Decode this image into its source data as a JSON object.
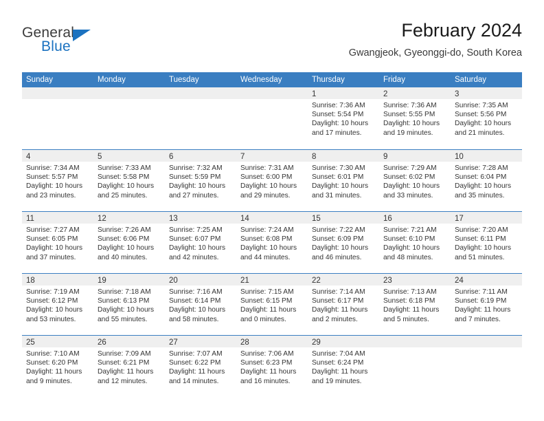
{
  "logo": {
    "word_top": "General",
    "word_bottom": "Blue"
  },
  "header": {
    "title": "February 2024",
    "location": "Gwangjeok, Gyeonggi-do, South Korea"
  },
  "calendar": {
    "weekdays": [
      "Sunday",
      "Monday",
      "Tuesday",
      "Wednesday",
      "Thursday",
      "Friday",
      "Saturday"
    ],
    "accent_color": "#3a7ec1",
    "day_band_color": "#efefef",
    "weeks": [
      [
        {
          "day": "",
          "empty": true
        },
        {
          "day": "",
          "empty": true
        },
        {
          "day": "",
          "empty": true
        },
        {
          "day": "",
          "empty": true
        },
        {
          "day": "1",
          "sunrise": "Sunrise: 7:36 AM",
          "sunset": "Sunset: 5:54 PM",
          "daylight1": "Daylight: 10 hours",
          "daylight2": "and 17 minutes."
        },
        {
          "day": "2",
          "sunrise": "Sunrise: 7:36 AM",
          "sunset": "Sunset: 5:55 PM",
          "daylight1": "Daylight: 10 hours",
          "daylight2": "and 19 minutes."
        },
        {
          "day": "3",
          "sunrise": "Sunrise: 7:35 AM",
          "sunset": "Sunset: 5:56 PM",
          "daylight1": "Daylight: 10 hours",
          "daylight2": "and 21 minutes."
        }
      ],
      [
        {
          "day": "4",
          "sunrise": "Sunrise: 7:34 AM",
          "sunset": "Sunset: 5:57 PM",
          "daylight1": "Daylight: 10 hours",
          "daylight2": "and 23 minutes."
        },
        {
          "day": "5",
          "sunrise": "Sunrise: 7:33 AM",
          "sunset": "Sunset: 5:58 PM",
          "daylight1": "Daylight: 10 hours",
          "daylight2": "and 25 minutes."
        },
        {
          "day": "6",
          "sunrise": "Sunrise: 7:32 AM",
          "sunset": "Sunset: 5:59 PM",
          "daylight1": "Daylight: 10 hours",
          "daylight2": "and 27 minutes."
        },
        {
          "day": "7",
          "sunrise": "Sunrise: 7:31 AM",
          "sunset": "Sunset: 6:00 PM",
          "daylight1": "Daylight: 10 hours",
          "daylight2": "and 29 minutes."
        },
        {
          "day": "8",
          "sunrise": "Sunrise: 7:30 AM",
          "sunset": "Sunset: 6:01 PM",
          "daylight1": "Daylight: 10 hours",
          "daylight2": "and 31 minutes."
        },
        {
          "day": "9",
          "sunrise": "Sunrise: 7:29 AM",
          "sunset": "Sunset: 6:02 PM",
          "daylight1": "Daylight: 10 hours",
          "daylight2": "and 33 minutes."
        },
        {
          "day": "10",
          "sunrise": "Sunrise: 7:28 AM",
          "sunset": "Sunset: 6:04 PM",
          "daylight1": "Daylight: 10 hours",
          "daylight2": "and 35 minutes."
        }
      ],
      [
        {
          "day": "11",
          "sunrise": "Sunrise: 7:27 AM",
          "sunset": "Sunset: 6:05 PM",
          "daylight1": "Daylight: 10 hours",
          "daylight2": "and 37 minutes."
        },
        {
          "day": "12",
          "sunrise": "Sunrise: 7:26 AM",
          "sunset": "Sunset: 6:06 PM",
          "daylight1": "Daylight: 10 hours",
          "daylight2": "and 40 minutes."
        },
        {
          "day": "13",
          "sunrise": "Sunrise: 7:25 AM",
          "sunset": "Sunset: 6:07 PM",
          "daylight1": "Daylight: 10 hours",
          "daylight2": "and 42 minutes."
        },
        {
          "day": "14",
          "sunrise": "Sunrise: 7:24 AM",
          "sunset": "Sunset: 6:08 PM",
          "daylight1": "Daylight: 10 hours",
          "daylight2": "and 44 minutes."
        },
        {
          "day": "15",
          "sunrise": "Sunrise: 7:22 AM",
          "sunset": "Sunset: 6:09 PM",
          "daylight1": "Daylight: 10 hours",
          "daylight2": "and 46 minutes."
        },
        {
          "day": "16",
          "sunrise": "Sunrise: 7:21 AM",
          "sunset": "Sunset: 6:10 PM",
          "daylight1": "Daylight: 10 hours",
          "daylight2": "and 48 minutes."
        },
        {
          "day": "17",
          "sunrise": "Sunrise: 7:20 AM",
          "sunset": "Sunset: 6:11 PM",
          "daylight1": "Daylight: 10 hours",
          "daylight2": "and 51 minutes."
        }
      ],
      [
        {
          "day": "18",
          "sunrise": "Sunrise: 7:19 AM",
          "sunset": "Sunset: 6:12 PM",
          "daylight1": "Daylight: 10 hours",
          "daylight2": "and 53 minutes."
        },
        {
          "day": "19",
          "sunrise": "Sunrise: 7:18 AM",
          "sunset": "Sunset: 6:13 PM",
          "daylight1": "Daylight: 10 hours",
          "daylight2": "and 55 minutes."
        },
        {
          "day": "20",
          "sunrise": "Sunrise: 7:16 AM",
          "sunset": "Sunset: 6:14 PM",
          "daylight1": "Daylight: 10 hours",
          "daylight2": "and 58 minutes."
        },
        {
          "day": "21",
          "sunrise": "Sunrise: 7:15 AM",
          "sunset": "Sunset: 6:15 PM",
          "daylight1": "Daylight: 11 hours",
          "daylight2": "and 0 minutes."
        },
        {
          "day": "22",
          "sunrise": "Sunrise: 7:14 AM",
          "sunset": "Sunset: 6:17 PM",
          "daylight1": "Daylight: 11 hours",
          "daylight2": "and 2 minutes."
        },
        {
          "day": "23",
          "sunrise": "Sunrise: 7:13 AM",
          "sunset": "Sunset: 6:18 PM",
          "daylight1": "Daylight: 11 hours",
          "daylight2": "and 5 minutes."
        },
        {
          "day": "24",
          "sunrise": "Sunrise: 7:11 AM",
          "sunset": "Sunset: 6:19 PM",
          "daylight1": "Daylight: 11 hours",
          "daylight2": "and 7 minutes."
        }
      ],
      [
        {
          "day": "25",
          "sunrise": "Sunrise: 7:10 AM",
          "sunset": "Sunset: 6:20 PM",
          "daylight1": "Daylight: 11 hours",
          "daylight2": "and 9 minutes."
        },
        {
          "day": "26",
          "sunrise": "Sunrise: 7:09 AM",
          "sunset": "Sunset: 6:21 PM",
          "daylight1": "Daylight: 11 hours",
          "daylight2": "and 12 minutes."
        },
        {
          "day": "27",
          "sunrise": "Sunrise: 7:07 AM",
          "sunset": "Sunset: 6:22 PM",
          "daylight1": "Daylight: 11 hours",
          "daylight2": "and 14 minutes."
        },
        {
          "day": "28",
          "sunrise": "Sunrise: 7:06 AM",
          "sunset": "Sunset: 6:23 PM",
          "daylight1": "Daylight: 11 hours",
          "daylight2": "and 16 minutes."
        },
        {
          "day": "29",
          "sunrise": "Sunrise: 7:04 AM",
          "sunset": "Sunset: 6:24 PM",
          "daylight1": "Daylight: 11 hours",
          "daylight2": "and 19 minutes."
        },
        {
          "day": "",
          "empty": true
        },
        {
          "day": "",
          "empty": true
        }
      ]
    ]
  }
}
